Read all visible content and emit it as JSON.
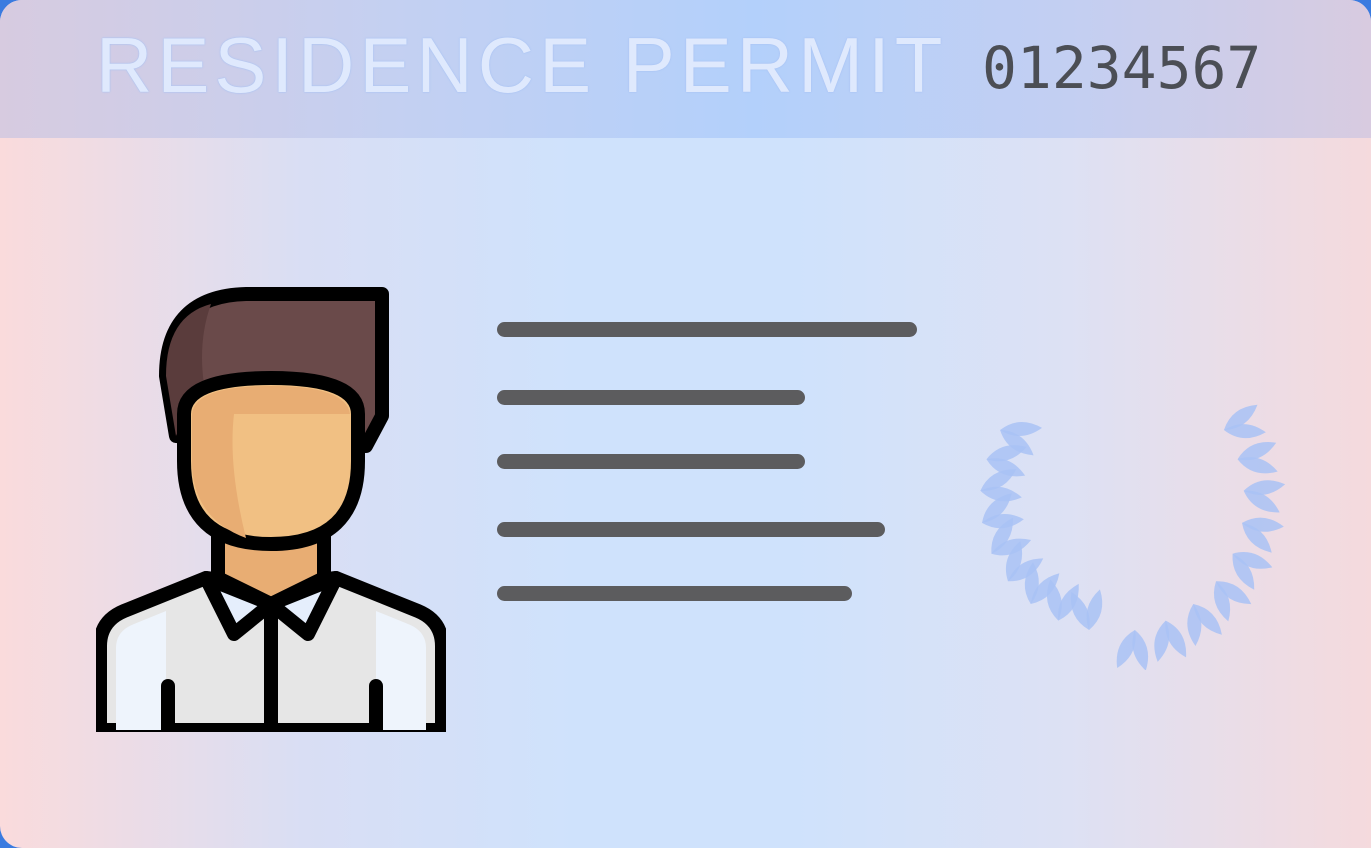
{
  "card": {
    "title": "RESIDENCE PERMIT",
    "number": "01234567"
  },
  "icons": {
    "photo": "person-avatar-icon",
    "seal": "laurel-wreath-icon"
  },
  "colors": {
    "header_text": "#dfe9fd",
    "number_text": "#4b4e55",
    "text_lines": "#5c5c5e",
    "wreath": "#a9c2f4"
  }
}
